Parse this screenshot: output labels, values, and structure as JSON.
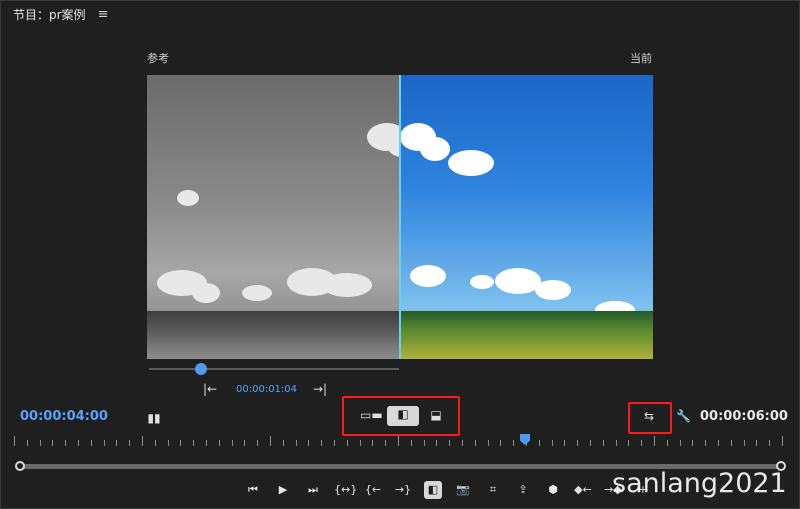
{
  "panel": {
    "title": "节目：pr案例",
    "menu_glyph": "≡"
  },
  "viewer": {
    "reference_label": "参考",
    "current_label": "当前"
  },
  "reference_scrubber": {
    "timecode": "00:00:01:04",
    "progress": 0.21
  },
  "timecodes": {
    "left": "00:00:04:00",
    "right": "00:00:06:00"
  },
  "comparison_modes": [
    "side-by-side",
    "vertical-split",
    "horizontal-split"
  ],
  "selected_comparison_mode": "vertical-split",
  "timeline": {
    "playhead_fraction": 0.66
  },
  "colors": {
    "accent": "#4d9bf2",
    "highlight_box": "#ff1a1a"
  },
  "icons": {
    "go_in": "|←",
    "go_out": "→|",
    "transport": [
      "⏮",
      "▶",
      "⏭",
      "{↔}",
      "{←",
      "→}",
      "◧",
      "📷",
      "⌗",
      "⇪",
      "⬢",
      "◆←",
      "→◆",
      "+"
    ]
  },
  "watermark": "sanlang2021"
}
